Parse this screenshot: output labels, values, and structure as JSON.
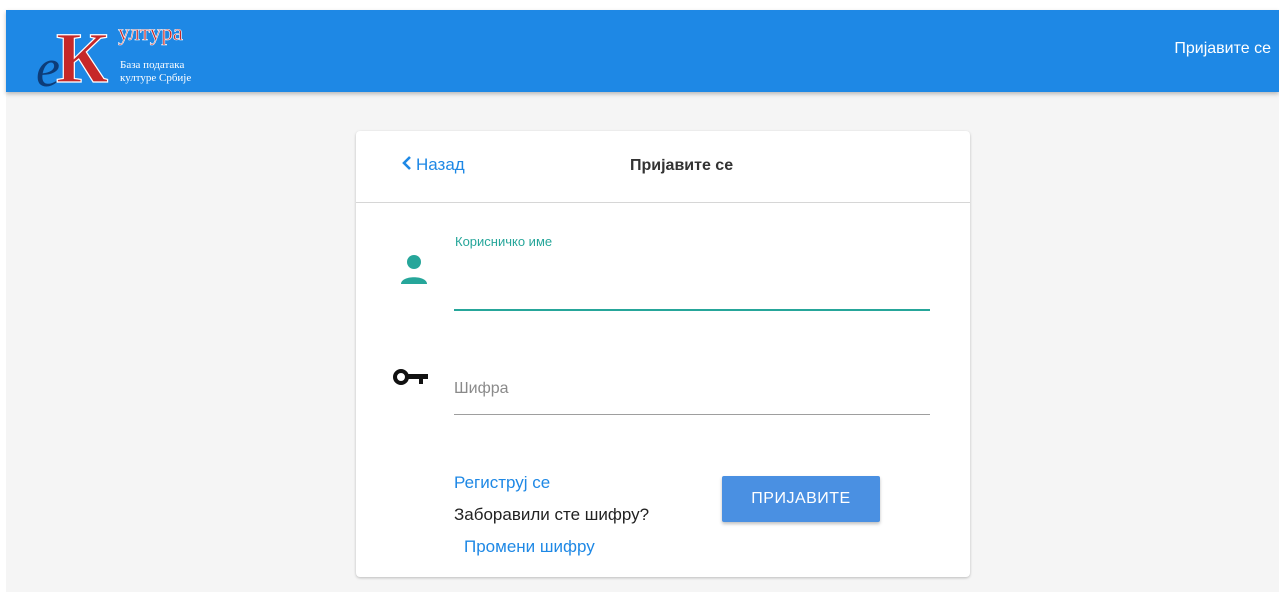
{
  "header": {
    "logo": {
      "title": "ултура",
      "letter_e": "e",
      "letter_k": "К",
      "subtitle_line1": "База података",
      "subtitle_line2": "културе Србије"
    },
    "login_link": "Пријавите се"
  },
  "card": {
    "back_label": "Назад",
    "title": "Пријавите се",
    "username_label": "Корисничко име",
    "username_value": "",
    "password_placeholder": "Шифра",
    "register_link": "Региструј се",
    "forgot_text": "Заборавили сте шифру?",
    "change_link": "Промени шифру",
    "submit_label": "ПРИЈАВИТЕ"
  },
  "icons": {
    "user": "user-icon",
    "key": "key-icon",
    "back": "chevron-left-icon"
  },
  "colors": {
    "appbar": "#1e88e5",
    "accent_teal": "#26a69a",
    "link_blue": "#1e88e5",
    "button_blue": "#4a90e2",
    "logo_red": "#c62828"
  }
}
